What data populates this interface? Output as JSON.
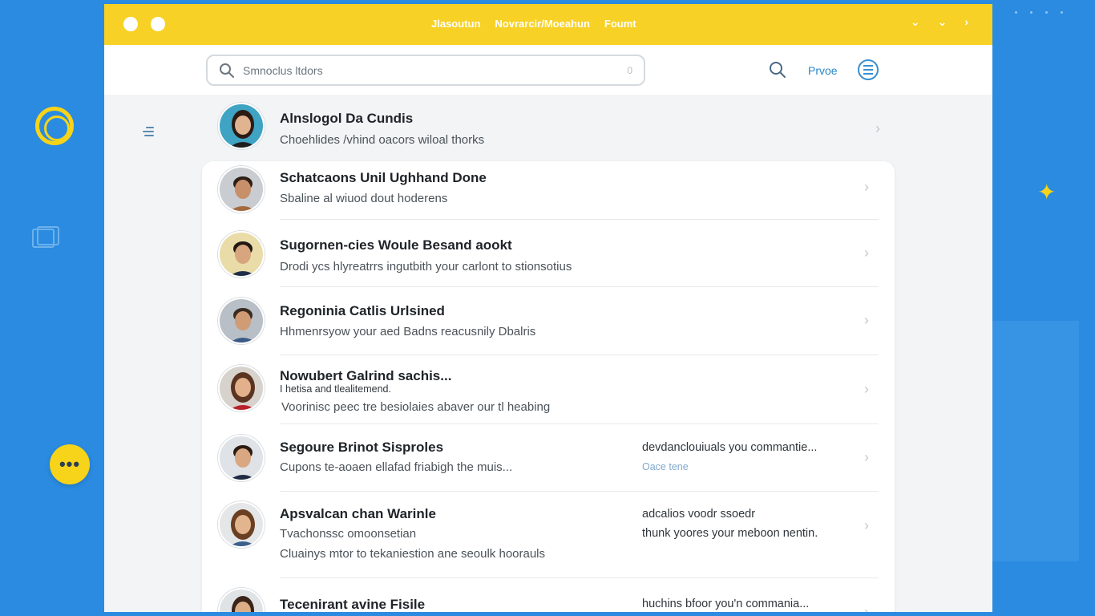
{
  "titlebar": {
    "menu": [
      "Jlasoutun",
      "Novrarcir/Moeahun",
      "Foumt"
    ],
    "controls": [
      "⌄",
      "⌄",
      "›"
    ]
  },
  "toolbar": {
    "search_placeholder": "Smnoclus ltdors",
    "search_count": "0",
    "link_label": "Prvoe"
  },
  "contacts": [
    {
      "name": "Alnslogol Da Cundis",
      "line1": "Choehlides /vhind oacors wiloal thorks",
      "skin": "#e0b48f",
      "hair": "#2b1b14",
      "shirt": "#1e1e1e"
    },
    {
      "name": "Schatcaons Unil Ughhand Done",
      "line1": "Sbaline al wiuod dout hoderens",
      "skin": "#c8906a",
      "hair": "#2d1e16",
      "shirt": "#a46a3e"
    },
    {
      "name": "Sugornen-cies Woule Besand aookt",
      "line1": "Drodi ycs hlyreatrrs ingutbith your carlont to stionsotius",
      "skin": "#d8a67e",
      "hair": "#221812",
      "shirt": "#1f2f4a"
    },
    {
      "name": "Regoninia Catlis Urlsined",
      "line1": "Hhmenrsyow your aed Badns reacusnily Dbalris",
      "skin": "#d09c76",
      "hair": "#3a2a1f",
      "shirt": "#3b5b86"
    },
    {
      "name": "Nowubert Galrind sachis...",
      "line_small": "I hetisa and tlealitemend.",
      "line1": "Voorinisc peec tre besiolaies abaver our tl heabing",
      "skin": "#e2b08a",
      "hair": "#5a3420",
      "shirt": "#b8222b"
    },
    {
      "name": "Segoure Brinot Sisproles",
      "line1": "Cupons te-aoaen ellafad friabigh the muis...",
      "right1": "devdanclouiuals you commantie...",
      "right2": "Oace tene",
      "skin": "#d9a883",
      "hair": "#2b1c13",
      "shirt": "#1f2a44"
    },
    {
      "name": "Apsvalcan chan Warinle",
      "line1": "Tvachonssc omoonsetian",
      "line2": "Cluainys mtor to tekaniestion ane seoulk hoorauls",
      "right1": "adcalios voodr ssoedr",
      "right2": "thunk yoores your meboon nentin.",
      "skin": "#e3b58f",
      "hair": "#6a3f22",
      "shirt": "#3c5f8a"
    },
    {
      "name": "Tecenirant avine Fisile",
      "right1": "huchins bfoor you'n commania...",
      "skin": "#dcae88",
      "hair": "#3a2418",
      "shirt": "#2a2a2a"
    }
  ]
}
